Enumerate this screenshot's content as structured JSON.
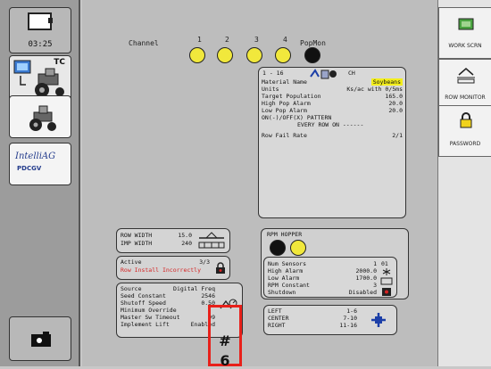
{
  "left_sidebar": {
    "clock": "03:25",
    "tc_label": "TC",
    "intellag_label": "IntelliAG",
    "pdcgv_label": "PDCGV"
  },
  "right_sidebar": {
    "work_screen": "WORK SCRN",
    "row_monitor": "ROW MONITOR",
    "password": "PASSWORD"
  },
  "channels": {
    "channel_label": "Channel",
    "numbers": [
      "1",
      "2",
      "3",
      "4"
    ],
    "popmon_label": "PopMon"
  },
  "info_panel": {
    "range": "1 - 16",
    "ch": "CH",
    "material_name_label": "Material Name",
    "material_name_value": "Soybeans",
    "units_label": "Units",
    "units_value": "Ks/ac with 0/5ms",
    "target_population_label": "Target Population",
    "target_population_value": "165.0",
    "high_pop_alarm_label": "High Pop Alarm",
    "high_pop_alarm_value": "20.0",
    "low_pop_alarm_label": "Low Pop Alarm",
    "low_pop_alarm_value": "20.0",
    "pattern_line1": "ON(-)/OFF(X) PATTERN",
    "pattern_line2": "EVERY ROW ON ------",
    "row_fail_rate_label": "Row Fail Rate",
    "row_fail_rate_value": "2/1"
  },
  "row_width": {
    "row_width_label": "ROW WIDTH",
    "row_width_value": "15.0",
    "imp_width_label": "IMP WIDTH",
    "imp_width_value": "240"
  },
  "active": {
    "label": "Active",
    "value": "3/3",
    "warning": "Row Install Incorrectly"
  },
  "source": {
    "source_label": "Source",
    "source_value": "Digital Freq",
    "seed_constant_label": "Seed Constant",
    "seed_constant_value": "2546",
    "shutoff_speed_label": "Shutoff Speed",
    "shutoff_speed_value": "0.50",
    "minimum_override_label": "Minimum Override",
    "master_sw_timeout_label": "Master Sw Timeout",
    "master_sw_timeout_value": "99",
    "implement_lift_label": "Implement Lift",
    "implement_lift_value": "Enabled"
  },
  "rpm": {
    "title": "RPM HOPPER"
  },
  "sensors": {
    "num_sensors_label": "Num Sensors",
    "num_sensors_value": "1",
    "num_sensors_extra": "01",
    "high_alarm_label": "High Alarm",
    "high_alarm_value": "2000.0",
    "low_alarm_label": "Low Alarm",
    "low_alarm_value": "1700.0",
    "rpm_constant_label": "RPM Constant",
    "rpm_constant_value": "3",
    "shutdown_label": "Shutdown",
    "shutdown_value": "Disabled"
  },
  "sections": {
    "left_label": "LEFT",
    "left_value": "1-6",
    "center_label": "CENTER",
    "center_value": "7-10",
    "right_label": "RIGHT",
    "right_value": "11-16"
  },
  "annotation": {
    "text": "#",
    "text2": "6",
    "color": "#e8201a"
  }
}
